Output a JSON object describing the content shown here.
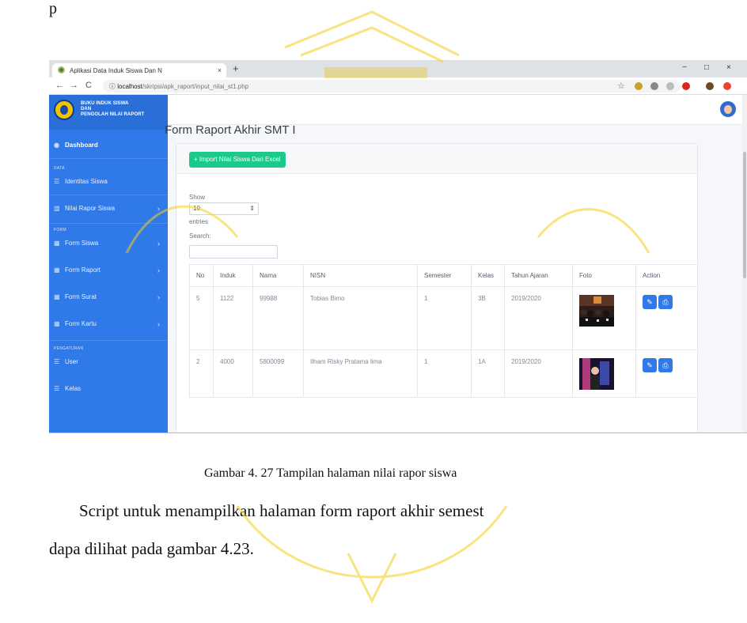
{
  "document": {
    "top_fragment": "p",
    "caption": "Gambar 4. 27 Tampilan halaman nilai rapor siswa",
    "paragraph_line1": "Script untuk menampilkan halaman form raport akhir semest",
    "paragraph_line2": "dapa dilihat pada gambar 4.23."
  },
  "browser": {
    "tab_title": "Aplikasi Data Induk Siswa Dan N",
    "tab_close": "×",
    "new_tab": "+",
    "url_host": "localhost",
    "url_path": "/skripsi/apk_raport/input_nilai_st1.php",
    "window_buttons": [
      "−",
      "□",
      "×"
    ]
  },
  "sidebar": {
    "brand_lines": [
      "BUKU INDUK SISWA",
      "DAN",
      "PENGOLAH NILAI RAPORT"
    ],
    "dashboard": "Dashboard",
    "section_data": "DATA",
    "section_form": "FORM",
    "section_settings": "PENGATURAN",
    "items": [
      {
        "label": "Identitas Siswa",
        "icon": "table-icon",
        "chevron": false
      },
      {
        "label": "Nilai Rapor Siswa",
        "icon": "chart-icon",
        "chevron": true
      },
      {
        "label": "Form Siswa",
        "icon": "table-icon",
        "chevron": true
      },
      {
        "label": "Form Raport",
        "icon": "table-icon",
        "chevron": true
      },
      {
        "label": "Form Surat",
        "icon": "table-icon",
        "chevron": true
      },
      {
        "label": "Form Kartu",
        "icon": "table-icon",
        "chevron": true
      },
      {
        "label": "User",
        "icon": "list-icon",
        "chevron": false
      },
      {
        "label": "Kelas",
        "icon": "list-icon",
        "chevron": false
      }
    ],
    "chevron": "›"
  },
  "main": {
    "title": "Form Raport Akhir SMT I",
    "import_button": "+ Import Nilai Siswa Dari Excel",
    "show_label": "Show",
    "length_value": "10",
    "entries_label": "entries",
    "search_label": "Search:",
    "columns": [
      "No",
      "Induk",
      "Nama",
      "NISN",
      "Semester",
      "Kelas",
      "Tahun Ajaran",
      "Foto",
      "Action"
    ],
    "rows": [
      {
        "no": "5",
        "induk": "1122",
        "nama": "99988",
        "nisn": "Tobias Bimo",
        "semester": "1",
        "kelas": "3B",
        "tahun": "2019/2020"
      },
      {
        "no": "2",
        "induk": "4000",
        "nama": "5800099",
        "nisn": "Ilham Risky Pratama lima",
        "semester": "1",
        "kelas": "1A",
        "tahun": "2019/2020"
      }
    ],
    "edit_icon": "✎",
    "print_icon": "⎙"
  },
  "colors": {
    "sidebar": "#2f79e8",
    "import_button": "#1cc88a",
    "action_button": "#2f79e8",
    "watermark": "#f5d000"
  }
}
